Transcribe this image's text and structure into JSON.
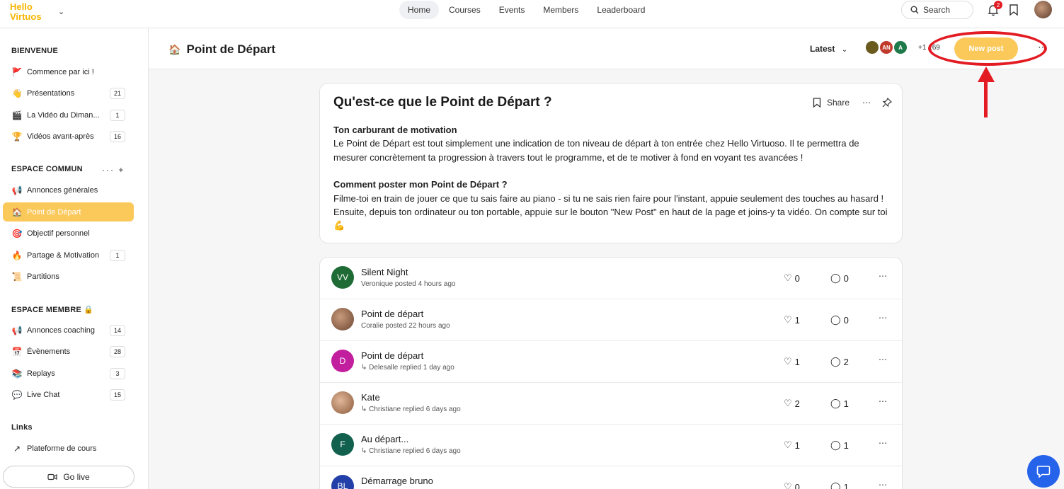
{
  "topbar": {
    "logo_line1": "Hello",
    "logo_line2": "Virtuos",
    "nav": [
      "Home",
      "Courses",
      "Events",
      "Members",
      "Leaderboard"
    ],
    "search_label": "Search",
    "notifications_count": "2"
  },
  "sidebar": {
    "sections": [
      {
        "title": "BIENVENUE"
      },
      {
        "title": "ESPACE COMMUN"
      },
      {
        "title": "ESPACE MEMBRE 🔒"
      },
      {
        "title": "Links"
      }
    ],
    "items": [
      {
        "label": "Commence par ici !",
        "icon": "🚩",
        "count": ""
      },
      {
        "label": "Présentations",
        "icon": "👋",
        "count": "21"
      },
      {
        "label": "La Vidéo du Diman...",
        "icon": "🎬",
        "count": "1"
      },
      {
        "label": "Vidéos avant-après",
        "icon": "🏆",
        "count": "16"
      },
      {
        "label": "Annonces générales",
        "icon": "📢",
        "count": ""
      },
      {
        "label": "Point de Départ",
        "icon": "🏠",
        "count": ""
      },
      {
        "label": "Objectif personnel",
        "icon": "🎯",
        "count": ""
      },
      {
        "label": "Partage & Motivation",
        "icon": "🔥",
        "count": "1"
      },
      {
        "label": "Partitions",
        "icon": "📜",
        "count": ""
      },
      {
        "label": "Annonces coaching",
        "icon": "📢",
        "count": "14"
      },
      {
        "label": "Évènements",
        "icon": "📅",
        "count": "28"
      },
      {
        "label": "Replays",
        "icon": "📚",
        "count": "3"
      },
      {
        "label": "Live Chat",
        "icon": "💬",
        "count": "15"
      },
      {
        "label": "Plateforme de cours",
        "icon": "↗",
        "count": ""
      }
    ],
    "golive_label": "Go live"
  },
  "space": {
    "icon": "🏠",
    "title": "Point de Départ",
    "sort_label": "Latest",
    "member_avatars": [
      {
        "initials": "",
        "color": "#6b5a1e"
      },
      {
        "initials": "AN",
        "color": "#c0392b"
      },
      {
        "initials": "A",
        "color": "#1e7a4a"
      }
    ],
    "member_count": "+1 169",
    "new_post_label": "New post"
  },
  "intro": {
    "title": "Qu'est-ce que le Point de Départ ?",
    "share_label": "Share",
    "heading1": "Ton carburant de motivation",
    "para1": "Le Point de Départ est tout simplement une indication de ton niveau de départ à ton entrée chez Hello Virtuoso. Il te permettra de mesurer concrètement ta progression à travers tout le programme, et de te motiver à fond en voyant tes avancées !",
    "heading2": "Comment poster mon Point de Départ ?",
    "para2": "Filme-toi en train de jouer ce que tu sais faire au piano - si tu ne sais rien faire pour l'instant, appuie seulement des touches au hasard ! Ensuite, depuis ton ordinateur ou ton portable, appuie sur le bouton \"New Post\" en haut de la page et joins-y ta vidéo. On compte sur toi 💪"
  },
  "posts": [
    {
      "initials": "VV",
      "color": "#1e6b35",
      "title": "Silent Night",
      "meta": "Veronique posted 4 hours ago",
      "likes": "0",
      "comments": "0"
    },
    {
      "initials": "",
      "color": "#8a5a3a",
      "title": "Point de départ",
      "meta": "Coralie posted 22 hours ago",
      "likes": "1",
      "comments": "0"
    },
    {
      "initials": "D",
      "color": "#c21f9e",
      "title": "Point de départ",
      "meta": "↳ Delesalle replied 1 day ago",
      "likes": "1",
      "comments": "2"
    },
    {
      "initials": "",
      "color": "#c89a7c",
      "title": "Kate",
      "meta": "↳ Christiane replied 6 days ago",
      "likes": "2",
      "comments": "1"
    },
    {
      "initials": "F",
      "color": "#12614f",
      "title": "Au départ...",
      "meta": "↳ Christiane replied 6 days ago",
      "likes": "1",
      "comments": "1"
    },
    {
      "initials": "BL",
      "color": "#2340a8",
      "title": "Démarrage bruno",
      "meta": "",
      "likes": "0",
      "comments": "1"
    }
  ]
}
